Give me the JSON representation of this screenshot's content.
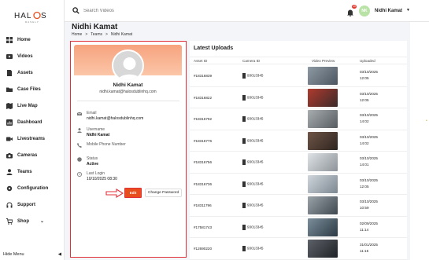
{
  "brand": {
    "logo_text": "HALOS",
    "logo_sub": "DASHLY"
  },
  "sidebar": {
    "items": [
      {
        "label": "Home",
        "icon": "grid-icon"
      },
      {
        "label": "Videos",
        "icon": "video-icon"
      },
      {
        "label": "Assets",
        "icon": "doc-icon"
      },
      {
        "label": "Case Files",
        "icon": "folder-icon"
      },
      {
        "label": "Live Map",
        "icon": "map-icon"
      },
      {
        "label": "Dashboard",
        "icon": "dashboard-icon"
      },
      {
        "label": "Livestreams",
        "icon": "livestream-icon"
      },
      {
        "label": "Cameras",
        "icon": "camera-icon"
      },
      {
        "label": "Teams",
        "icon": "person-icon"
      },
      {
        "label": "Configuration",
        "icon": "gear-icon"
      },
      {
        "label": "Support",
        "icon": "headset-icon"
      },
      {
        "label": "Shop",
        "icon": "cart-icon"
      }
    ],
    "hide_menu": "Hide Menu"
  },
  "topbar": {
    "search_placeholder": "Search Videos",
    "notification_count": "10",
    "user_name": "Nidhi Kamat",
    "user_initials": "NK"
  },
  "page": {
    "title": "Nidhi Kamat",
    "breadcrumb": [
      "Home",
      "Teams",
      "Nidhi Kamat"
    ],
    "breadcrumb_sep": ">"
  },
  "profile": {
    "name": "Nidhi Kamat",
    "email_header": "nidhi.kamat@halosdublinhq.com",
    "email_label": "Email",
    "email_value": "nidhi.kamat@halosdublinhq.com",
    "username_label": "Username",
    "username_value": "Nidhi Kamat",
    "phone_label": "Mobile Phone Number",
    "status_label": "Status",
    "status_value": "Active",
    "last_login_label": "Last Login",
    "last_login_value": "10/10/2025 08:30",
    "edit_button": "Edit",
    "change_password_button": "Change Password"
  },
  "uploads": {
    "title": "Latest Uploads",
    "columns": [
      "Asset ID",
      "Camera ID",
      "Video Preview",
      "Uploaded"
    ],
    "rows": [
      {
        "asset": "#18316839",
        "camera": "93013345",
        "date": "03/10/2025",
        "time": "12:05",
        "thumb": [
          "#8e9aa3",
          "#4b5560"
        ]
      },
      {
        "asset": "#18316822",
        "camera": "93013345",
        "date": "03/10/2025",
        "time": "12:05",
        "thumb": [
          "#b03a2e",
          "#3b2b2a"
        ]
      },
      {
        "asset": "#18316792",
        "camera": "93013345",
        "date": "03/10/2025",
        "time": "14:02",
        "thumb": [
          "#a8adb0",
          "#565c60"
        ]
      },
      {
        "asset": "#18316776",
        "camera": "93013345",
        "date": "03/10/2025",
        "time": "14:02",
        "thumb": [
          "#6f5446",
          "#2e2520"
        ]
      },
      {
        "asset": "#18316756",
        "camera": "93013345",
        "date": "03/10/2025",
        "time": "14:01",
        "thumb": [
          "#dfe3e6",
          "#8d9399"
        ]
      },
      {
        "asset": "#18316736",
        "camera": "93013345",
        "date": "03/10/2025",
        "time": "12:05",
        "thumb": [
          "#cfd6dc",
          "#7c8790"
        ]
      },
      {
        "asset": "#18311796",
        "camera": "93013345",
        "date": "03/10/2025",
        "time": "10:59",
        "thumb": [
          "#9aa3a8",
          "#3f4850"
        ]
      },
      {
        "asset": "#17581743",
        "camera": "93013345",
        "date": "02/09/2025",
        "time": "11:14",
        "thumb": [
          "#7b8e9b",
          "#2c3a44"
        ]
      },
      {
        "asset": "#12690220",
        "camera": "93013345",
        "date": "31/01/2025",
        "time": "11:15",
        "thumb": [
          "#5d6168",
          "#1f2226"
        ]
      }
    ]
  },
  "colors": {
    "accent": "#e84e1b",
    "highlight": "#e0303a",
    "banner": "#f7a37e",
    "avatar": "#b9e2a7"
  }
}
